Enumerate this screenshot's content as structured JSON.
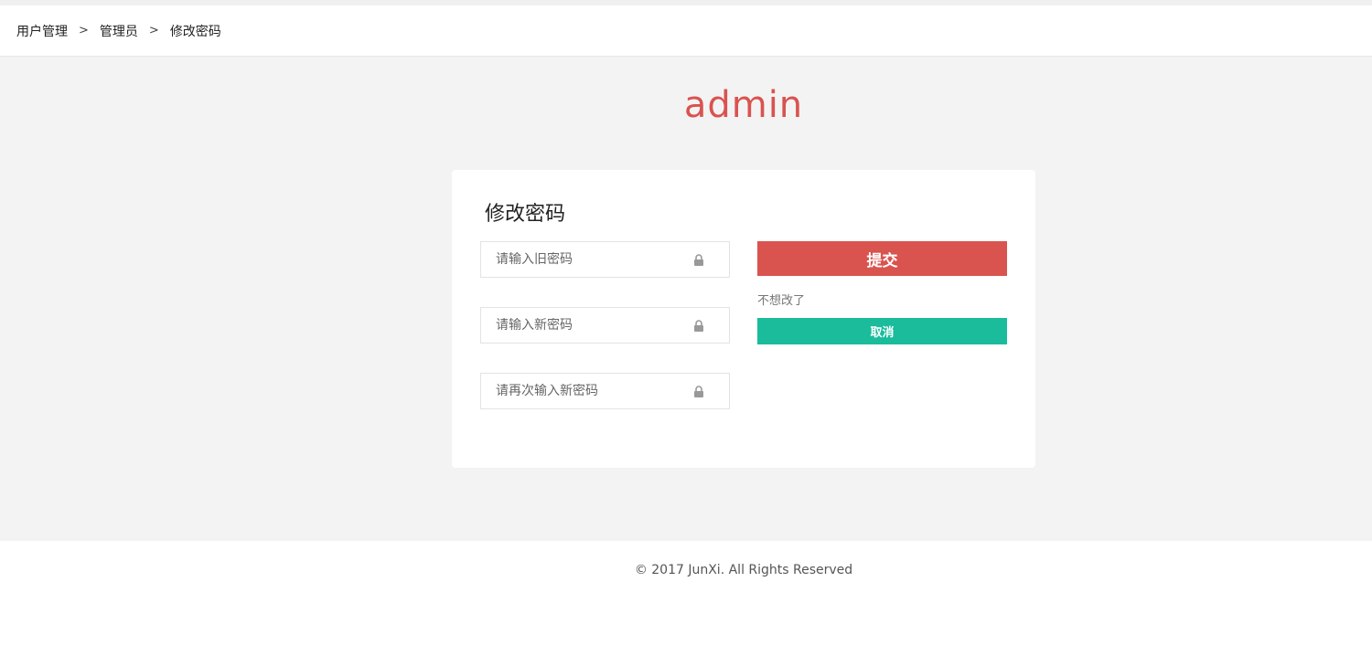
{
  "breadcrumb": {
    "items": [
      "用户管理",
      "管理员",
      "修改密码"
    ],
    "separator": ">"
  },
  "brand": {
    "text": "admin",
    "color": "#d9534f"
  },
  "form": {
    "title": "修改密码",
    "old_password_placeholder": "请输入旧密码",
    "new_password_placeholder": "请输入新密码",
    "confirm_password_placeholder": "请再次输入新密码",
    "submit_label": "提交",
    "hint_text": "不想改了",
    "cancel_label": "取消",
    "field_icon": "lock-icon"
  },
  "colors": {
    "accent": "#d9534f",
    "cancel": "#1abc9c",
    "background": "#f3f3f3"
  },
  "footer": {
    "text": "© 2017 JunXi. All Rights Reserved"
  }
}
